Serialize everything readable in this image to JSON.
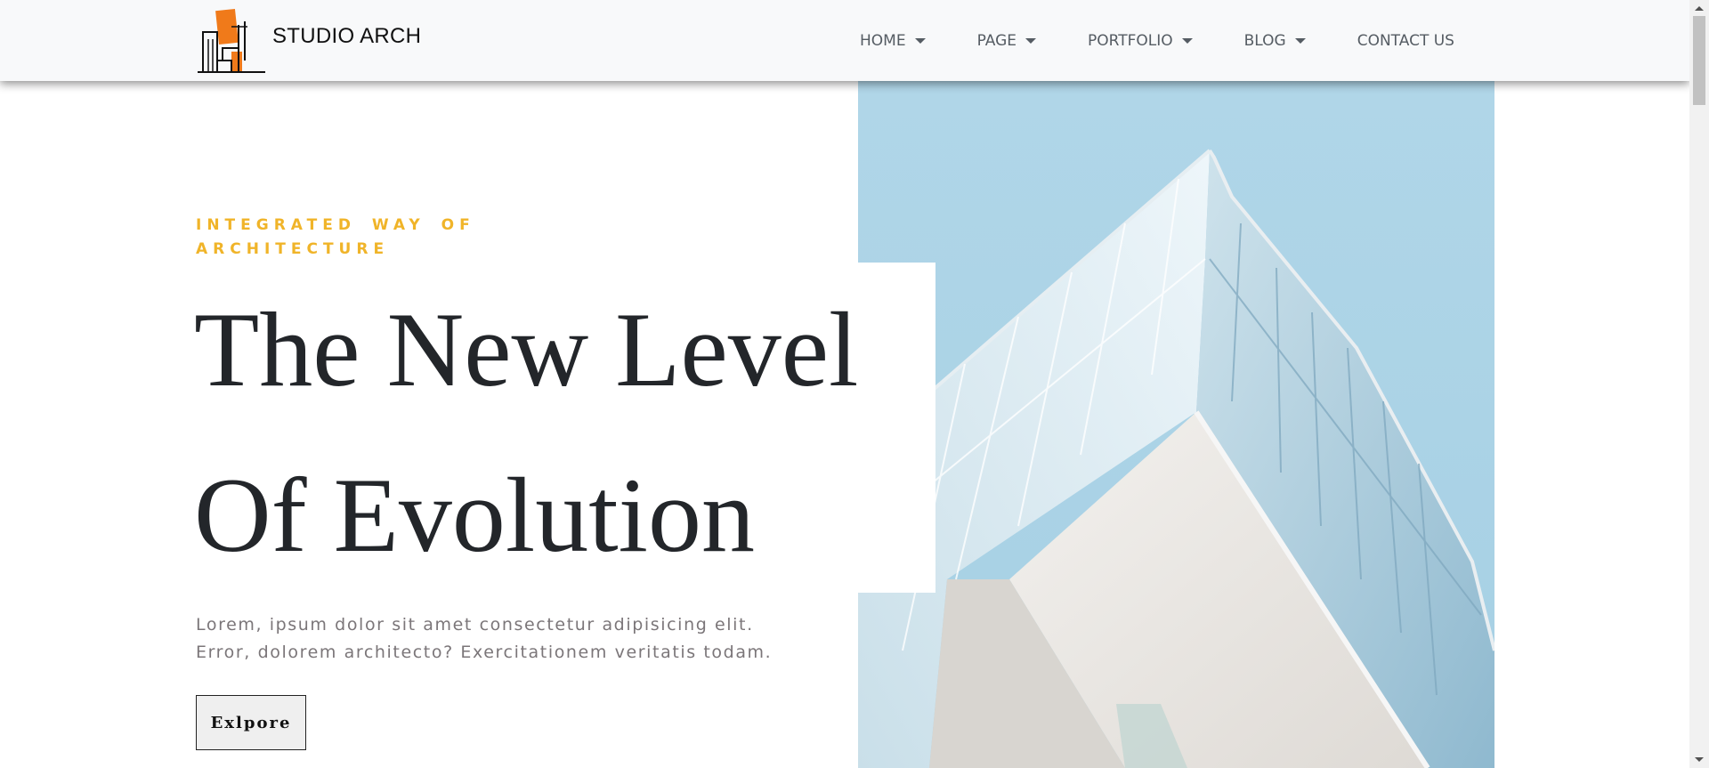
{
  "brand": {
    "name": "STUDIO ARCH",
    "logo_icon": "building-logo-icon"
  },
  "nav": {
    "items": [
      {
        "label": "HOME",
        "has_dropdown": true
      },
      {
        "label": "PAGE",
        "has_dropdown": true
      },
      {
        "label": "PORTFOLIO",
        "has_dropdown": true
      },
      {
        "label": "BLOG",
        "has_dropdown": true
      },
      {
        "label": "CONTACT US",
        "has_dropdown": false
      }
    ]
  },
  "hero": {
    "eyebrow": "INTEGRATED WAY OF ARCHITECTURE",
    "headline_line1": "The New Level",
    "headline_line2": "Of Evolution",
    "lede": "Lorem, ipsum dolor sit amet consectetur adipisicing elit. Error, dolorem architecto? Exercitationem veritatis todam.",
    "cta_label": "Exlpore",
    "image_subject": "glass-building-photo"
  },
  "colors": {
    "accent": "#f0b429",
    "heading": "#23262a",
    "body_text": "#7b7679",
    "nav_bg": "#f8f9fa",
    "nav_text": "#555c63",
    "logo_orange": "#f07a1a",
    "sky": "#aed5e6"
  }
}
